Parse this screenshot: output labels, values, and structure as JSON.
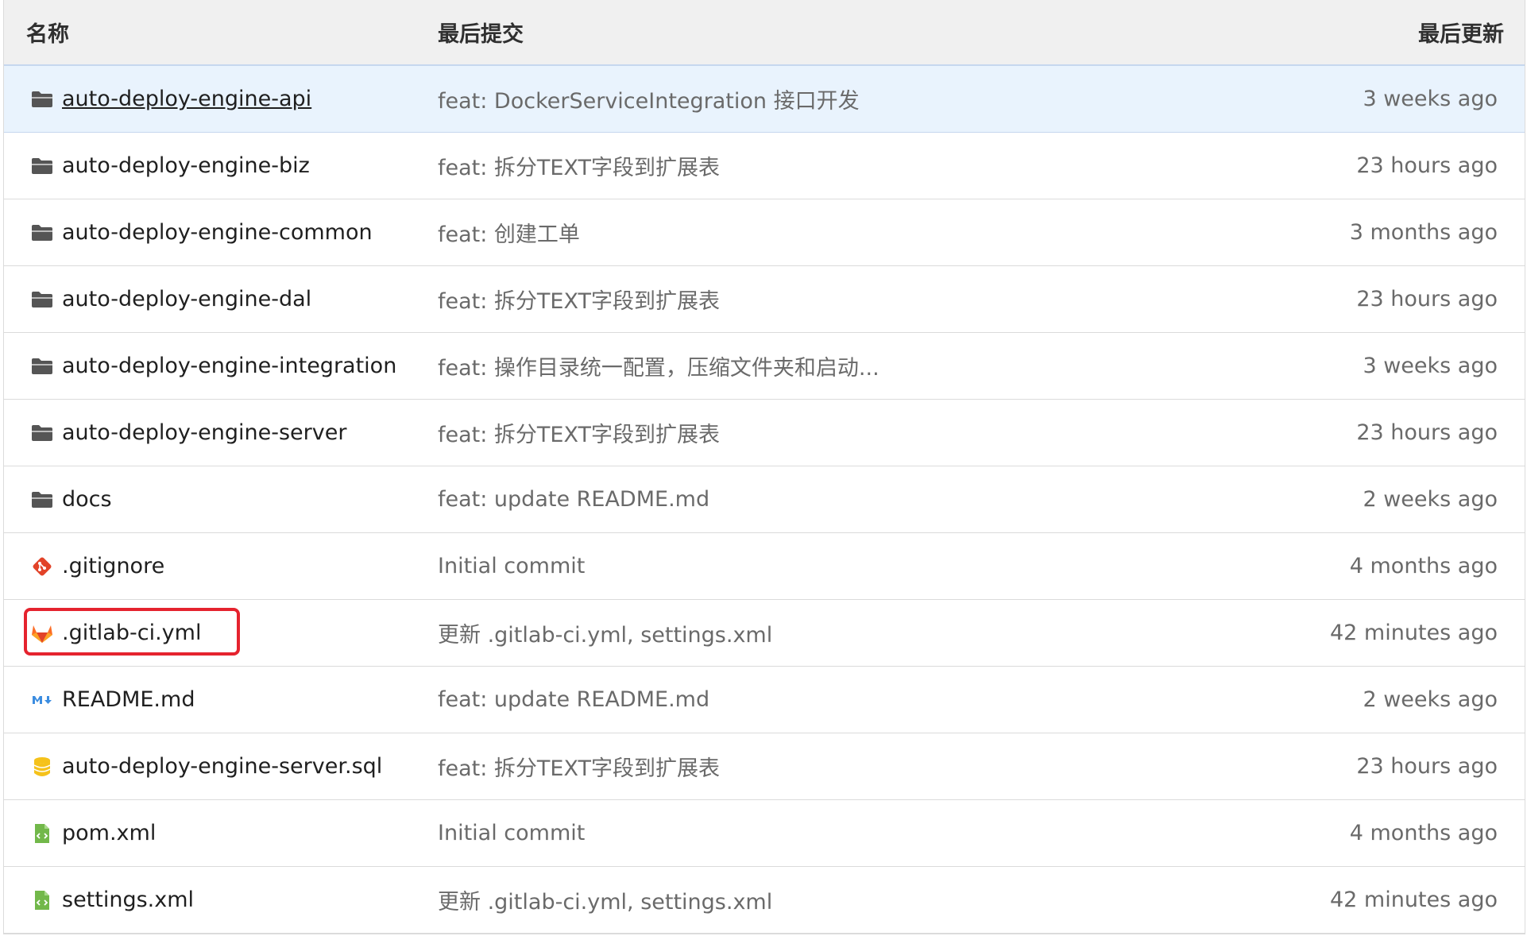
{
  "header": {
    "name_col": "名称",
    "commit_col": "最后提交",
    "updated_col": "最后更新"
  },
  "rows": [
    {
      "icon": "folder-icon",
      "name": "auto-deploy-engine-api",
      "commit": "feat: DockerServiceIntegration 接口开发",
      "updated": "3 weeks ago"
    },
    {
      "icon": "folder-icon",
      "name": "auto-deploy-engine-biz",
      "commit": "feat: 拆分TEXT字段到扩展表",
      "updated": "23 hours ago"
    },
    {
      "icon": "folder-icon",
      "name": "auto-deploy-engine-common",
      "commit": "feat: 创建工单",
      "updated": "3 months ago"
    },
    {
      "icon": "folder-icon",
      "name": "auto-deploy-engine-dal",
      "commit": "feat: 拆分TEXT字段到扩展表",
      "updated": "23 hours ago"
    },
    {
      "icon": "folder-icon",
      "name": "auto-deploy-engine-integration",
      "commit": "feat: 操作目录统一配置，压缩文件夹和启动...",
      "updated": "3 weeks ago"
    },
    {
      "icon": "folder-icon",
      "name": "auto-deploy-engine-server",
      "commit": "feat: 拆分TEXT字段到扩展表",
      "updated": "23 hours ago"
    },
    {
      "icon": "folder-icon",
      "name": "docs",
      "commit": "feat: update README.md",
      "updated": "2 weeks ago"
    },
    {
      "icon": "git-icon",
      "name": ".gitignore",
      "commit": "Initial commit",
      "updated": "4 months ago"
    },
    {
      "icon": "gitlab-icon",
      "name": ".gitlab-ci.yml",
      "commit": "更新 .gitlab-ci.yml, settings.xml",
      "updated": "42 minutes ago"
    },
    {
      "icon": "markdown-icon",
      "name": "README.md",
      "commit": "feat: update README.md",
      "updated": "2 weeks ago"
    },
    {
      "icon": "database-icon",
      "name": "auto-deploy-engine-server.sql",
      "commit": "feat: 拆分TEXT字段到扩展表",
      "updated": "23 hours ago"
    },
    {
      "icon": "xml-file-icon",
      "name": "pom.xml",
      "commit": "Initial commit",
      "updated": "4 months ago"
    },
    {
      "icon": "xml-file-icon",
      "name": "settings.xml",
      "commit": "更新 .gitlab-ci.yml, settings.xml",
      "updated": "42 minutes ago"
    }
  ],
  "colors": {
    "folder": "#555555",
    "git": "#e24329",
    "gitlab": "#fc6d26",
    "markdown": "#3c8de0",
    "database": "#f5c21b",
    "xml": "#72b84a",
    "highlight": "#e5232e",
    "selected_row_bg": "#e9f3fd"
  }
}
